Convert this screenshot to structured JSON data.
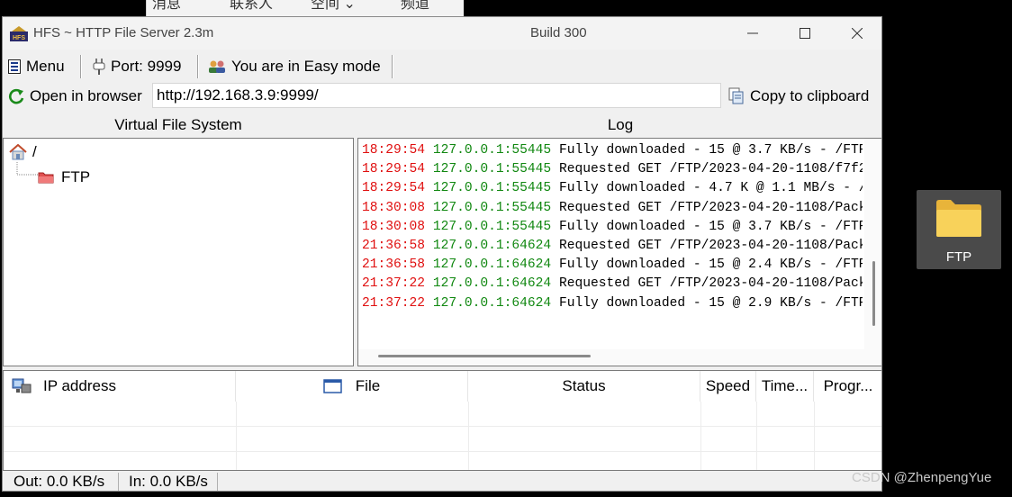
{
  "window": {
    "title": "HFS ~ HTTP File Server 2.3m",
    "build": "Build 300"
  },
  "toolbar": {
    "menu_label": "Menu",
    "port_label": "Port: 9999",
    "mode_label": "You are in Easy mode"
  },
  "urlbar": {
    "open_label": "Open in browser",
    "url": "http://192.168.3.9:9999/",
    "copy_label": "Copy to clipboard"
  },
  "vfs": {
    "header": "Virtual File System",
    "root": "/",
    "child": "FTP"
  },
  "log": {
    "header": "Log",
    "lines": [
      {
        "time": "18:29:54",
        "ip": "127.0.0.1:55445",
        "msg": "Fully downloaded - 15 @ 3.7 KB/s - /FTP"
      },
      {
        "time": "18:29:54",
        "ip": "127.0.0.1:55445",
        "msg": "Requested GET /FTP/2023-04-20-1108/f7f2"
      },
      {
        "time": "18:29:54",
        "ip": "127.0.0.1:55445",
        "msg": "Fully downloaded - 4.7 K @ 1.1 MB/s - /"
      },
      {
        "time": "18:30:08",
        "ip": "127.0.0.1:55445",
        "msg": "Requested GET /FTP/2023-04-20-1108/Pack"
      },
      {
        "time": "18:30:08",
        "ip": "127.0.0.1:55445",
        "msg": "Fully downloaded - 15 @ 3.7 KB/s - /FTP"
      },
      {
        "time": "21:36:58",
        "ip": "127.0.0.1:64624",
        "msg": "Requested GET /FTP/2023-04-20-1108/Pack"
      },
      {
        "time": "21:36:58",
        "ip": "127.0.0.1:64624",
        "msg": "Fully downloaded - 15 @ 2.4 KB/s - /FTP"
      },
      {
        "time": "21:37:22",
        "ip": "127.0.0.1:64624",
        "msg": "Requested GET /FTP/2023-04-20-1108/Pack"
      },
      {
        "time": "21:37:22",
        "ip": "127.0.0.1:64624",
        "msg": "Fully downloaded - 15 @ 2.9 KB/s - /FTP"
      }
    ]
  },
  "connections": {
    "columns": {
      "ip": "IP address",
      "file": "File",
      "status": "Status",
      "speed": "Speed",
      "time": "Time...",
      "progress": "Progr..."
    }
  },
  "statusbar": {
    "out": "Out: 0.0 KB/s",
    "in": "In: 0.0 KB/s"
  },
  "desktop": {
    "folder_label": "FTP",
    "watermark": "CSDN @ZhenpengYue"
  },
  "background_window": {
    "tabs": [
      "消息",
      "联系人",
      "空间 ⌄",
      "频道"
    ]
  }
}
